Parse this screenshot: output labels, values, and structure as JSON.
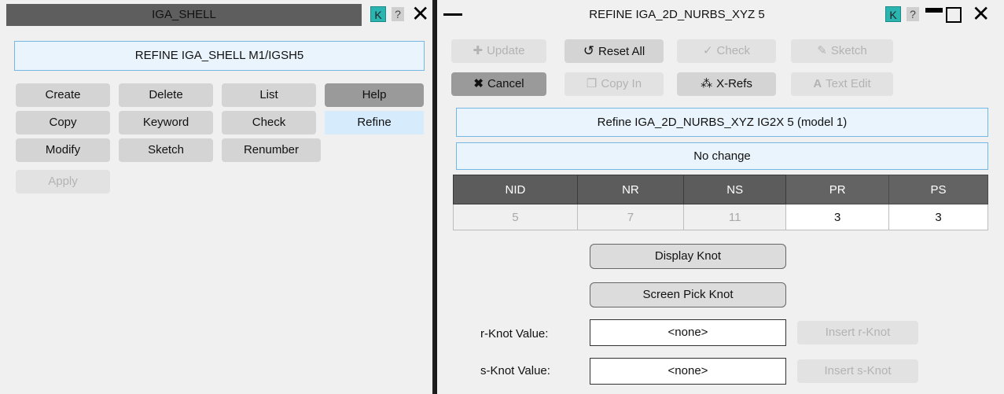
{
  "left": {
    "title": "IGA_SHELL",
    "command": "REFINE IGA_SHELL M1/IGSH5",
    "buttons": {
      "create": "Create",
      "delete": "Delete",
      "list": "List",
      "help": "Help",
      "copy": "Copy",
      "keyword": "Keyword",
      "check": "Check",
      "refine": "Refine",
      "modify": "Modify",
      "sketch": "Sketch",
      "renumber": "Renumber",
      "apply": "Apply"
    },
    "k_label": "K",
    "q_label": "?"
  },
  "right": {
    "title": "REFINE IGA_2D_NURBS_XYZ 5",
    "k_label": "K",
    "q_label": "?",
    "toolbar": {
      "update": "Update",
      "reset_all": "Reset All",
      "check": "Check",
      "sketch": "Sketch",
      "cancel": "Cancel",
      "copy_in": "Copy In",
      "xrefs": "X-Refs",
      "text_edit": "Text Edit"
    },
    "info": "Refine IGA_2D_NURBS_XYZ IG2X 5 (model 1)",
    "status": "No change",
    "table": {
      "headers": [
        "NID",
        "NR",
        "NS",
        "PR",
        "PS"
      ],
      "values": [
        "5",
        "7",
        "11",
        "3",
        "3"
      ]
    },
    "display_knot": "Display Knot",
    "screen_pick_knot": "Screen Pick Knot",
    "r_knot": {
      "label": "r-Knot Value:",
      "value": "<none>",
      "button": "Insert r-Knot"
    },
    "s_knot": {
      "label": "s-Knot Value:",
      "value": "<none>",
      "button": "Insert s-Knot"
    }
  },
  "colors": {
    "accent": "#2bb5b1",
    "highlight": "#d6ebfb",
    "header": "#5c5c5c"
  }
}
